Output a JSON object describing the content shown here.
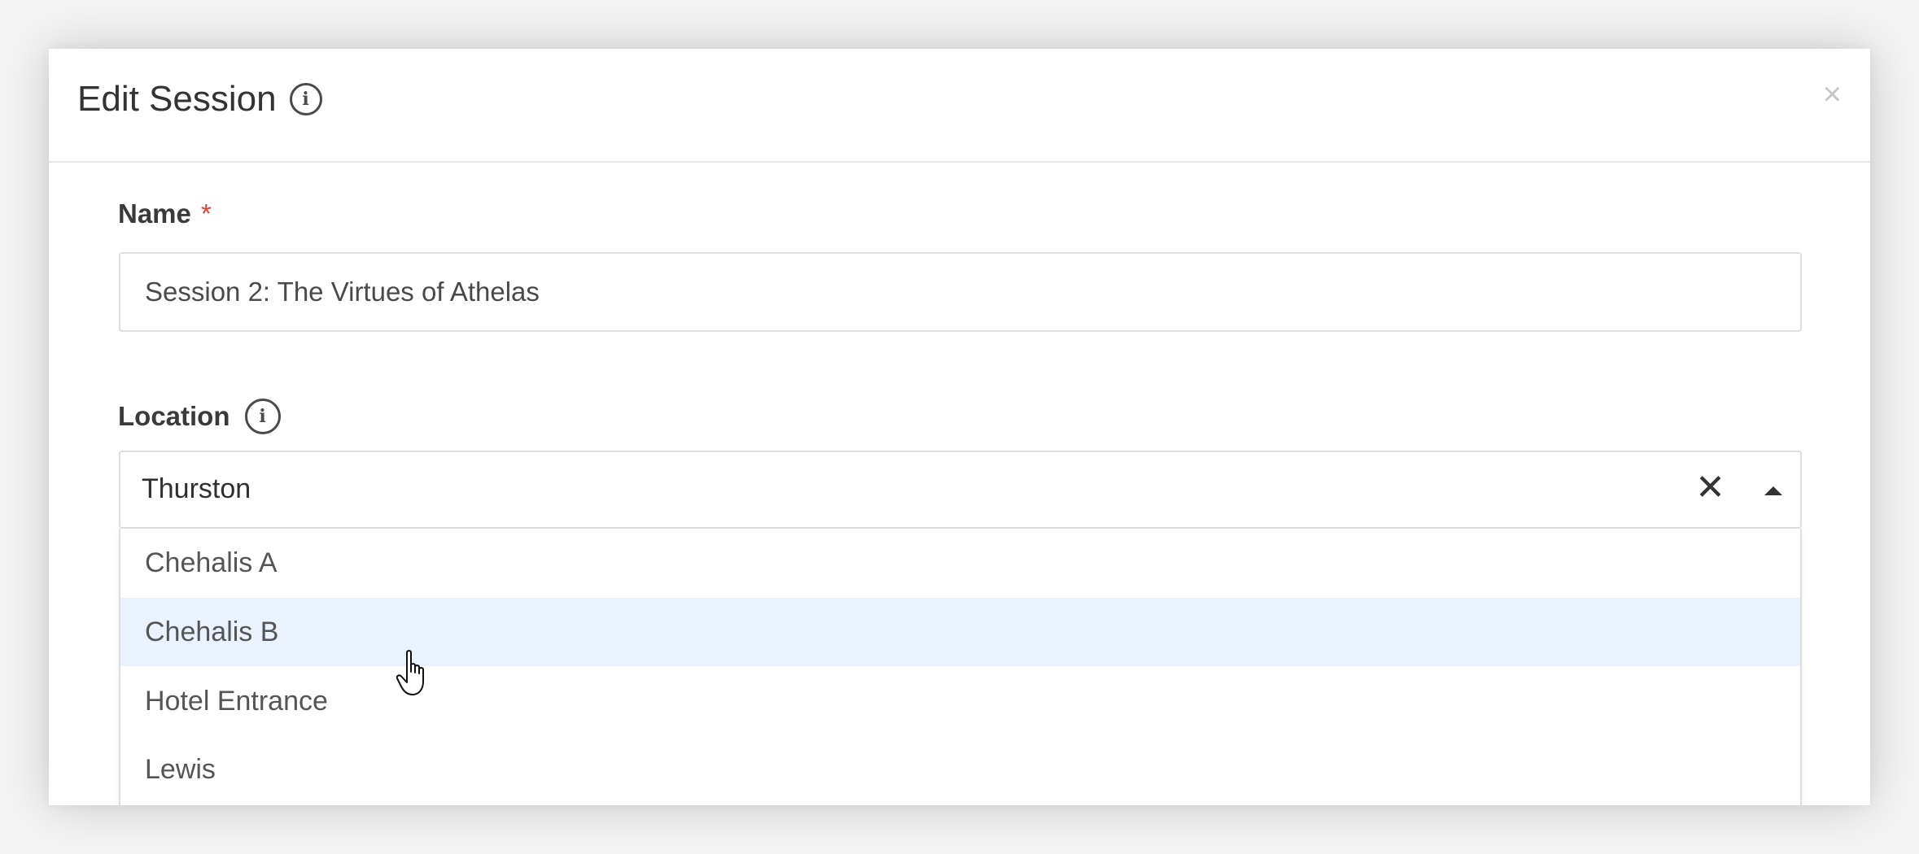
{
  "modal": {
    "title": "Edit Session",
    "close_label": "×"
  },
  "form": {
    "name": {
      "label": "Name",
      "required_marker": "*",
      "value": "Session 2: The Virtues of Athelas"
    },
    "location": {
      "label": "Location",
      "selected": "Thurston",
      "clear_glyph": "✕",
      "options": [
        {
          "label": "Chehalis A",
          "hovered": false
        },
        {
          "label": "Chehalis B",
          "hovered": true
        },
        {
          "label": "Hotel Entrance",
          "hovered": false
        },
        {
          "label": "Lewis",
          "hovered": false
        }
      ]
    }
  },
  "icons": {
    "info": "info-icon",
    "close": "close-icon",
    "clear": "clear-icon",
    "caret": "caret-up-icon",
    "cursor": "hand-pointer-icon"
  },
  "colors": {
    "required": "#e0413a",
    "option_hover": "#eaf2fd"
  }
}
